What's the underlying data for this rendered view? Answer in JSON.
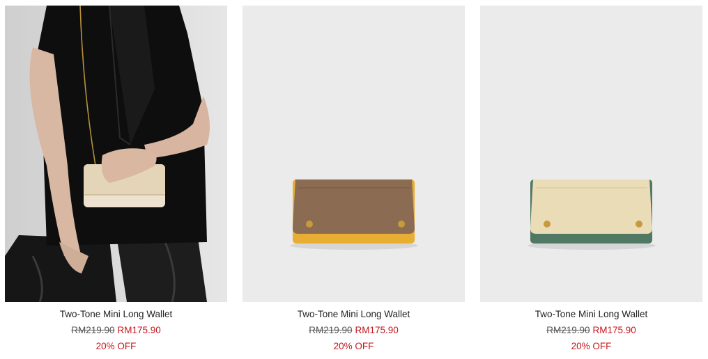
{
  "products": [
    {
      "name": "Two-Tone Mini Long Wallet",
      "original_price": "RM219.90",
      "sale_price": "RM175.90",
      "discount": "20% OFF",
      "image": "model-with-beige-wallet"
    },
    {
      "name": "Two-Tone Mini Long Wallet",
      "original_price": "RM219.90",
      "sale_price": "RM175.90",
      "discount": "20% OFF",
      "image": "brown-yellow-wallet",
      "colors": {
        "flap": "#8b6b52",
        "body": "#e8ae33"
      }
    },
    {
      "name": "Two-Tone Mini Long Wallet",
      "original_price": "RM219.90",
      "sale_price": "RM175.90",
      "discount": "20% OFF",
      "image": "cream-green-wallet",
      "colors": {
        "flap": "#ebdcb8",
        "body": "#507862"
      }
    }
  ]
}
